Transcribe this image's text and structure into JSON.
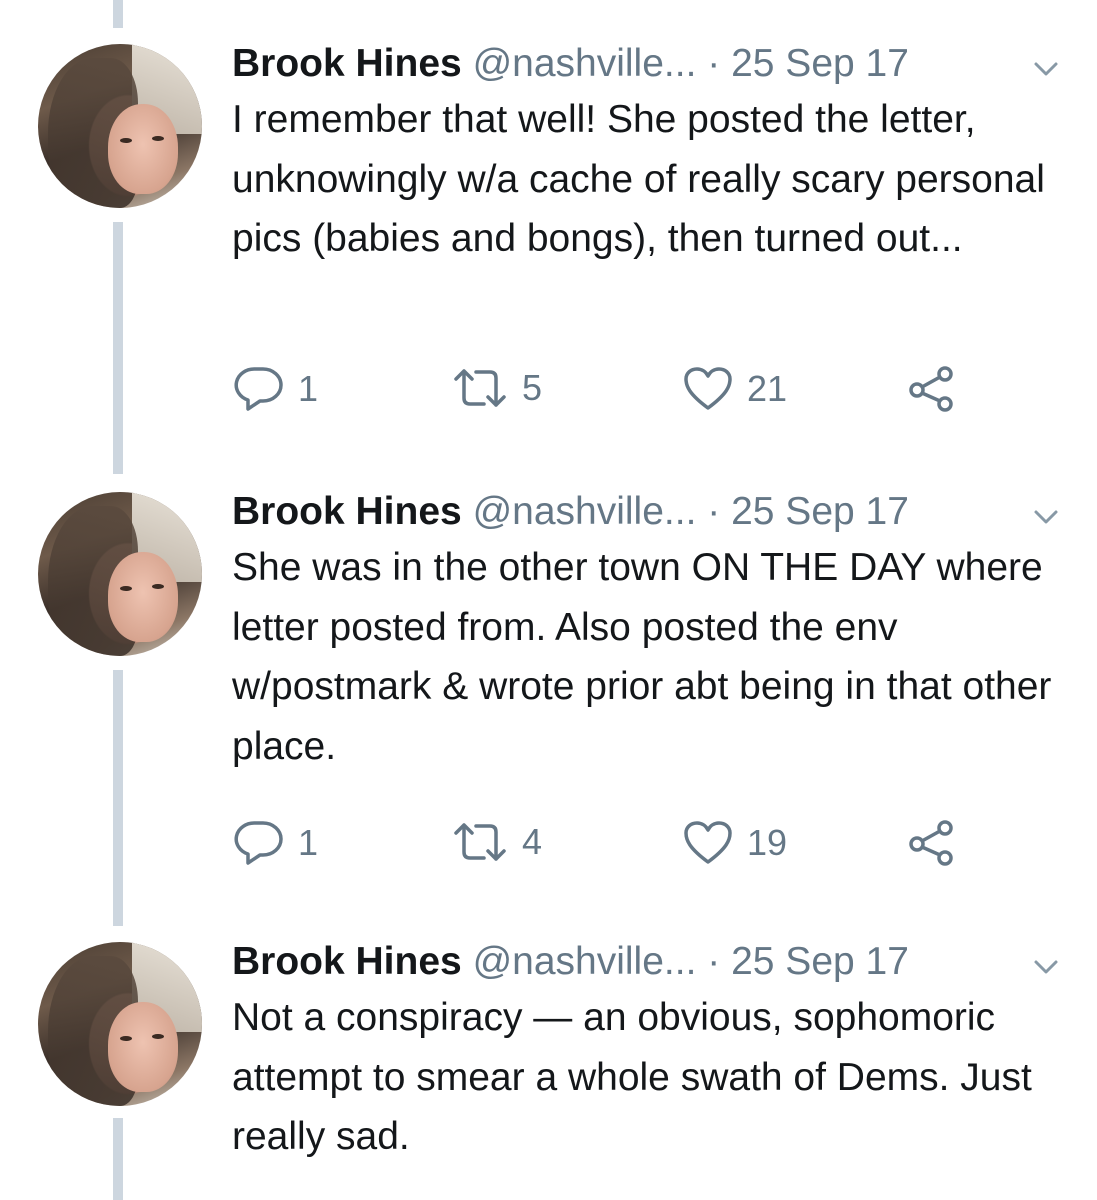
{
  "tweets": [
    {
      "name": "Brook Hines",
      "handle": "@nashville...",
      "date": "· 25 Sep 17",
      "text": "I remember that well! She posted the letter, unknowingly w/a cache of really scary personal pics (babies and bongs), then turned out...",
      "replies": "1",
      "retweets": "5",
      "likes": "21"
    },
    {
      "name": "Brook Hines",
      "handle": "@nashville...",
      "date": "· 25 Sep 17",
      "text": "She was in the other town ON THE DAY where letter posted from. Also posted the env w/postmark & wrote prior abt being in that other place.",
      "replies": "1",
      "retweets": "4",
      "likes": "19"
    },
    {
      "name": "Brook Hines",
      "handle": "@nashville...",
      "date": "· 25 Sep 17",
      "text": "Not a conspiracy — an obvious, sophomoric attempt to smear a whole swath of Dems. Just really sad."
    }
  ],
  "icons": {
    "reply": "reply-icon",
    "retweet": "retweet-icon",
    "like": "heart-icon",
    "share": "share-icon",
    "menu": "chevron-down-icon"
  },
  "colors": {
    "text": "#14171a",
    "secondary": "#657786",
    "thread_line": "#cdd6df"
  }
}
